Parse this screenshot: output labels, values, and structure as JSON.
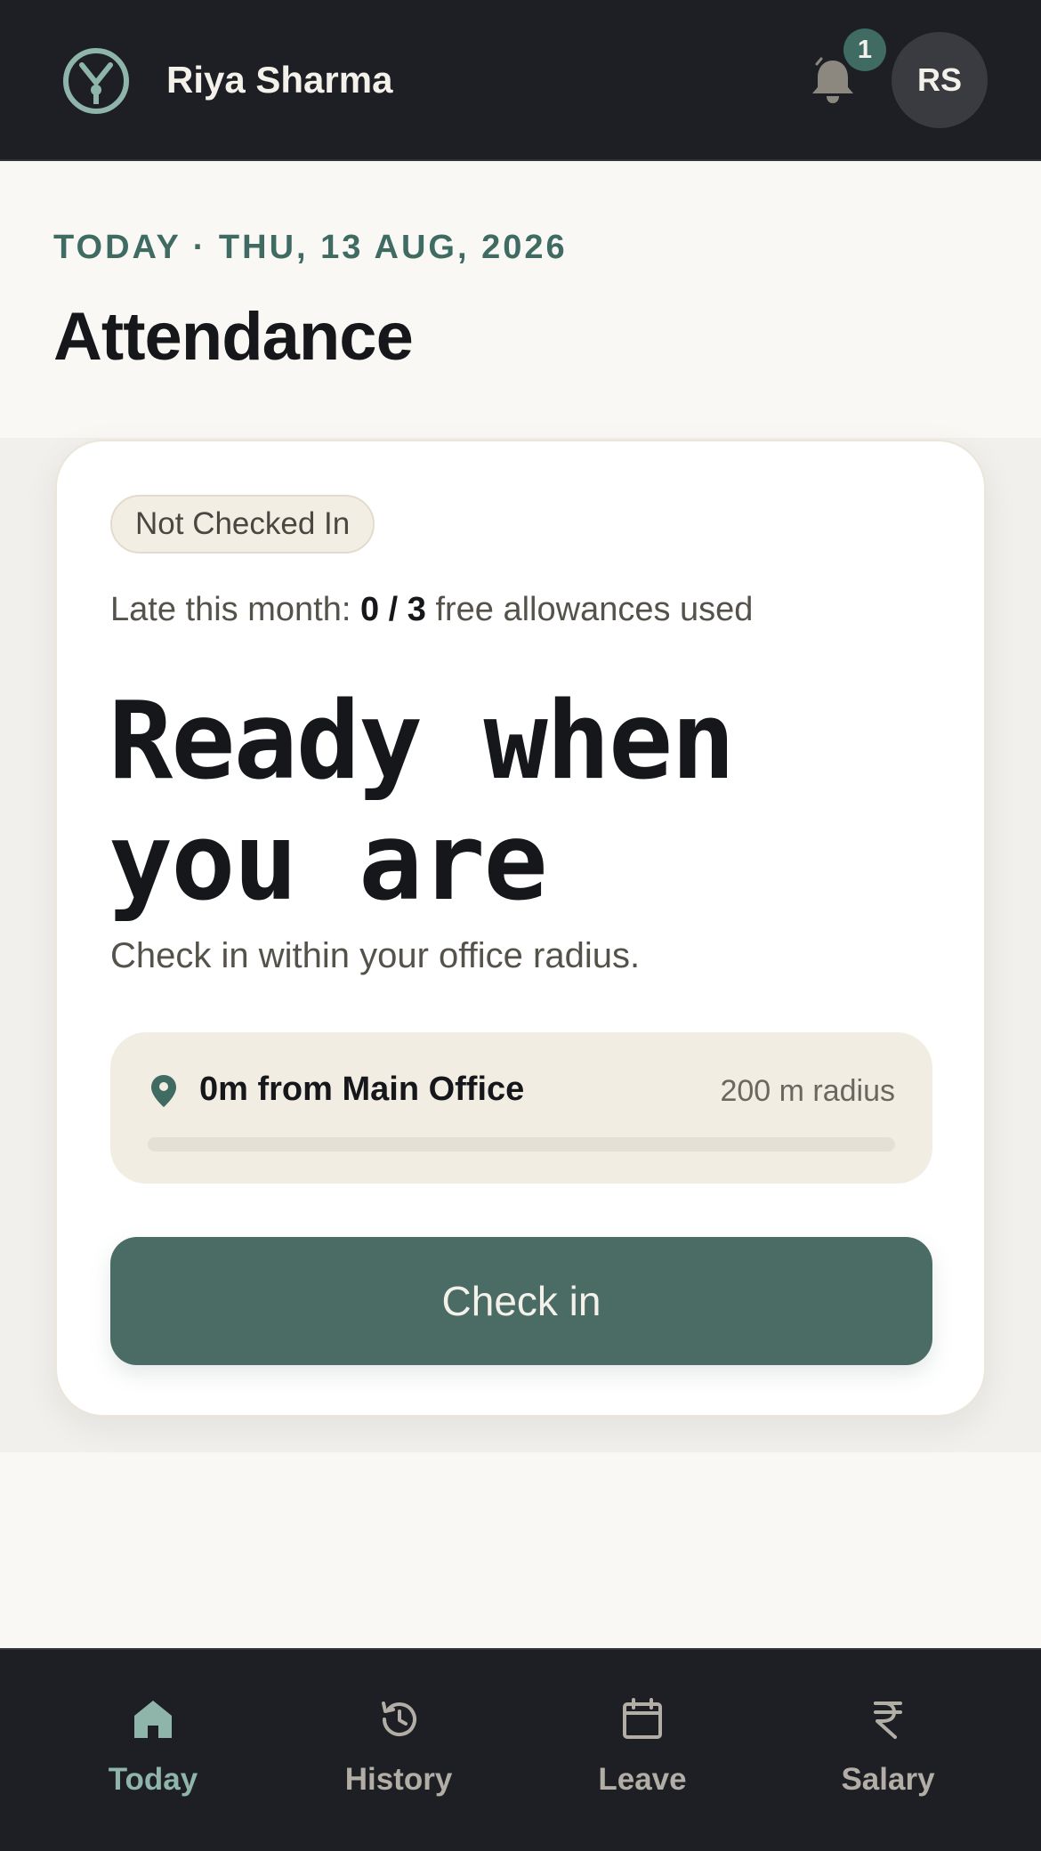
{
  "header": {
    "user_name": "Riya Sharma",
    "notification_count": "1",
    "avatar_initials": "RS"
  },
  "page": {
    "date_line": "TODAY · THU, 13 AUG, 2026",
    "title": "Attendance"
  },
  "card": {
    "status": "Not Checked In",
    "late_prefix": "Late this month: ",
    "late_count": "0 / 3",
    "late_suffix": " free allowances used",
    "hero_line1": "Ready when",
    "hero_line2": "you are",
    "hint": "Check in within your office radius.",
    "location": {
      "distance_text": "0m from Main Office",
      "radius_text": "200 m radius",
      "progress_fraction": 0
    },
    "checkin_label": "Check in"
  },
  "nav": {
    "items": [
      {
        "label": "Today",
        "icon": "home-icon",
        "active": true
      },
      {
        "label": "History",
        "icon": "history-icon",
        "active": false
      },
      {
        "label": "Leave",
        "icon": "calendar-icon",
        "active": false
      },
      {
        "label": "Salary",
        "icon": "rupee-icon",
        "active": false
      }
    ]
  },
  "colors": {
    "accent": "#3f6b62",
    "button": "#4a6c64",
    "dark_bar": "#1e1f24",
    "nav_active": "#8fb5ab"
  }
}
